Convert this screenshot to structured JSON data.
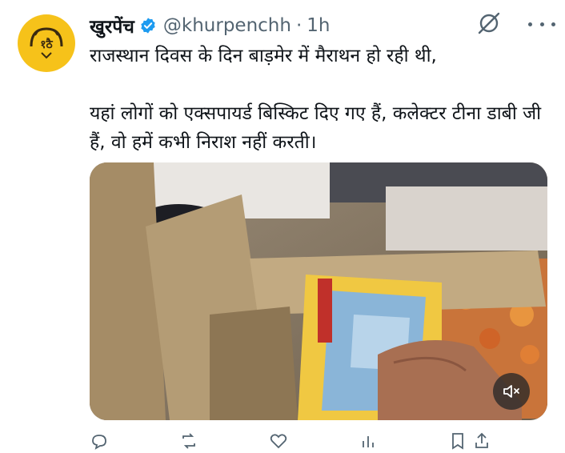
{
  "tweet": {
    "display_name": "खुरपेंच",
    "handle": "@khurpenchh",
    "separator": "·",
    "time": "1h",
    "text_line1": "राजस्थान दिवस के दिन बाड़मेर में मैराथन हो रही थी,",
    "text_line2": "यहां लोगों को एक्सपायर्ड बिस्किट दिए गए हैं, कलेक्टर टीना डाबी जी हैं, वो हमें कभी निराश नहीं करती।",
    "avatar_icon": "khurpench-logo-icon",
    "verified_icon": "verified-badge-icon",
    "media_icon": "video-thumbnail",
    "mute_icon": "speaker-muted-icon"
  },
  "colors": {
    "avatar_bg": "#f6c21a",
    "verified": "#1d9bf0",
    "muted_text": "#536471"
  }
}
